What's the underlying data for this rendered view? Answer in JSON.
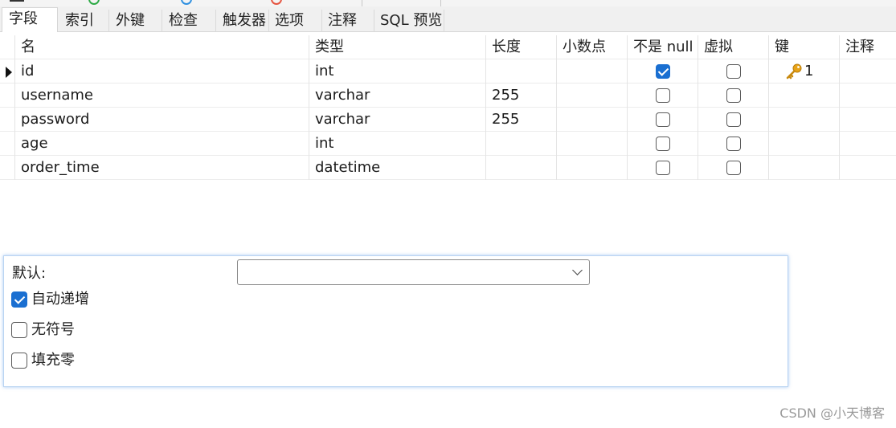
{
  "tabs": [
    {
      "label": "字段",
      "active": true
    },
    {
      "label": "索引",
      "active": false
    },
    {
      "label": "外键",
      "active": false
    },
    {
      "label": "检查",
      "active": false
    },
    {
      "label": "触发器",
      "active": false
    },
    {
      "label": "选项",
      "active": false
    },
    {
      "label": "注释",
      "active": false
    },
    {
      "label": "SQL 预览",
      "active": false
    }
  ],
  "columns": [
    "名",
    "类型",
    "长度",
    "小数点",
    "不是 null",
    "虚拟",
    "键",
    "注释"
  ],
  "rows": [
    {
      "name": "id",
      "type": "int",
      "length": "",
      "decimals": "",
      "not_null": true,
      "virtual": false,
      "key": "1",
      "comment": "",
      "current": true
    },
    {
      "name": "username",
      "type": "varchar",
      "length": "255",
      "decimals": "",
      "not_null": false,
      "virtual": false,
      "key": "",
      "comment": "",
      "current": false
    },
    {
      "name": "password",
      "type": "varchar",
      "length": "255",
      "decimals": "",
      "not_null": false,
      "virtual": false,
      "key": "",
      "comment": "",
      "current": false
    },
    {
      "name": "age",
      "type": "int",
      "length": "",
      "decimals": "",
      "not_null": false,
      "virtual": false,
      "key": "",
      "comment": "",
      "current": false
    },
    {
      "name": "order_time",
      "type": "datetime",
      "length": "",
      "decimals": "",
      "not_null": false,
      "virtual": false,
      "key": "",
      "comment": "",
      "current": false
    }
  ],
  "properties": {
    "default_label": "默认:",
    "default_value": "",
    "options": [
      {
        "label": "自动递增",
        "checked": true
      },
      {
        "label": "无符号",
        "checked": false
      },
      {
        "label": "填充零",
        "checked": false
      }
    ]
  },
  "watermark": "CSDN @小天博客",
  "colors": {
    "accent": "#1a6fd1",
    "key_icon": "#e8a317",
    "panel_border": "#b9d4f2"
  },
  "icons": {
    "row_indicator": "row-pointer-icon",
    "primary_key": "key-icon",
    "dropdown": "chevron-down-icon"
  }
}
